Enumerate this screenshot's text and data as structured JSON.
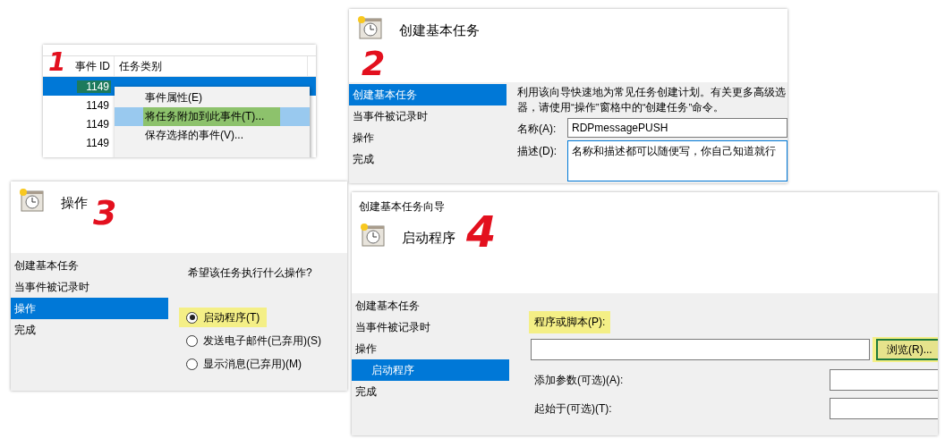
{
  "panels": [
    {
      "kind": "event_list",
      "annotation": "1",
      "columns": [
        "事件 ID",
        "任务类别"
      ],
      "rows": [
        {
          "event_id": "1149",
          "selected": true
        },
        {
          "event_id": "1149",
          "selected": false
        },
        {
          "event_id": "1149",
          "selected": false
        },
        {
          "event_id": "1149",
          "selected": false
        }
      ],
      "context_menu": [
        {
          "label": "事件属性(E)",
          "selected": false
        },
        {
          "label": "将任务附加到此事件(T)...",
          "selected": true
        },
        {
          "label": "保存选择的事件(V)...",
          "selected": false
        }
      ]
    },
    {
      "kind": "name_step",
      "annotation": "2",
      "title": "创建基本任务",
      "steps": [
        {
          "label": "创建基本任务",
          "selected": true
        },
        {
          "label": "当事件被记录时",
          "selected": false
        },
        {
          "label": "操作",
          "selected": false
        },
        {
          "label": "完成",
          "selected": false
        }
      ],
      "description": [
        "利用该向导快速地为常见任务创建计划。有关更多高级选",
        "器，请使用“操作”窗格中的“创建任务”命令。"
      ],
      "fields": [
        {
          "kind": "input",
          "label": "名称(A):",
          "value": "RDPmessagePUSH"
        },
        {
          "kind": "textarea",
          "label": "描述(D):",
          "value": "名称和描述都可以随便写，你自己知道就行"
        }
      ]
    },
    {
      "kind": "action_step",
      "annotation": "3",
      "title": "操作",
      "steps": [
        {
          "label": "创建基本任务",
          "selected": false
        },
        {
          "label": "当事件被记录时",
          "selected": false
        },
        {
          "label": "操作",
          "selected": true
        },
        {
          "label": "完成",
          "selected": false
        }
      ],
      "question": "希望该任务执行什么操作?",
      "options": [
        {
          "label": "启动程序(T)",
          "selected": true,
          "highlighted": true
        },
        {
          "label": "发送电子邮件(已弃用)(S)",
          "selected": false,
          "highlighted": false
        },
        {
          "label": "显示消息(已弃用)(M)",
          "selected": false,
          "highlighted": false
        }
      ]
    },
    {
      "kind": "program_step",
      "annotation": "4",
      "window_title": "创建基本任务向导",
      "title": "启动程序",
      "steps": [
        {
          "label": "创建基本任务",
          "selected": false
        },
        {
          "label": "当事件被记录时",
          "selected": false
        },
        {
          "label": "操作",
          "selected": false,
          "children": [
            {
              "label": "启动程序",
              "selected": true
            }
          ]
        },
        {
          "label": "完成",
          "selected": false
        }
      ],
      "program": {
        "label": "程序或脚本(P):",
        "highlighted": true
      },
      "browse_button": {
        "label": "浏览(R)...",
        "highlighted": true
      },
      "optional_fields": [
        {
          "label": "添加参数(可选)(A):"
        },
        {
          "label": "起始于(可选)(T):"
        }
      ]
    }
  ]
}
